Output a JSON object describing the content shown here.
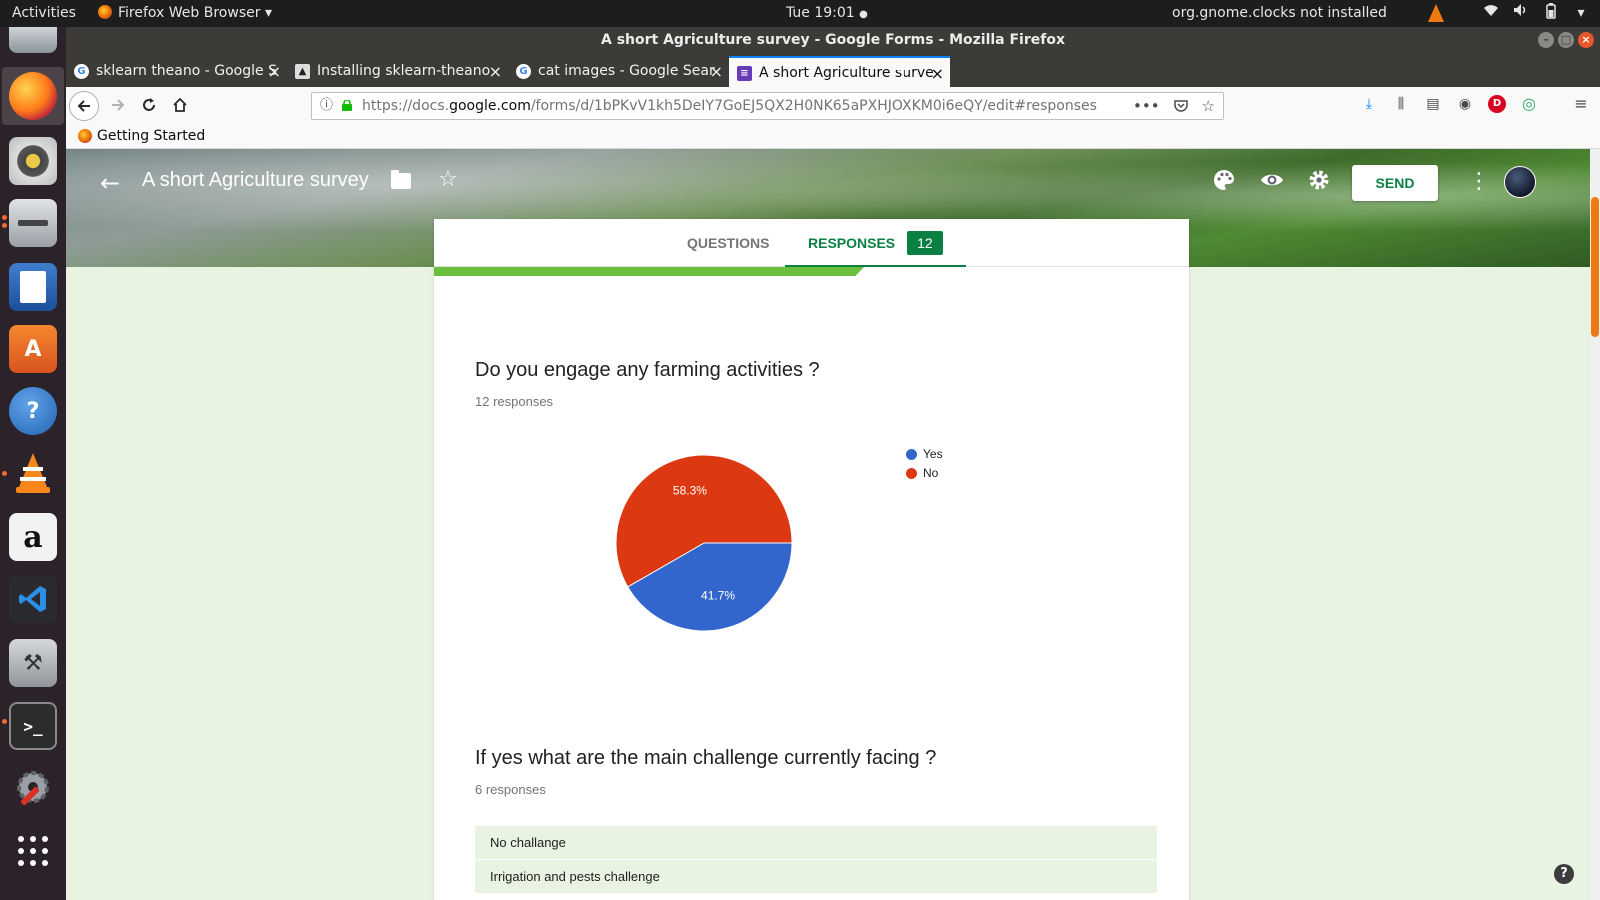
{
  "topbar": {
    "activities": "Activities",
    "app_name": "Firefox Web Browser",
    "clock": "Tue 19:01",
    "notice": "org.gnome.clocks not installed"
  },
  "window": {
    "title": "A short Agriculture survey - Google Forms - Mozilla Firefox"
  },
  "tabs": [
    {
      "label": "sklearn theano - Google S",
      "favicon": "google-g-icon"
    },
    {
      "label": "Installing sklearn-theano",
      "favicon": "site-icon"
    },
    {
      "label": "cat images - Google Sear",
      "favicon": "google-g-icon"
    },
    {
      "label": "A short Agriculture surve",
      "favicon": "forms-icon",
      "active": true
    }
  ],
  "navbar": {
    "url_prefix": "https://docs.",
    "url_domain": "google.com",
    "url_path": "/forms/d/1bPKvV1kh5DeIY7GoEJ5QX2H0NK65aPXHJOXKM0i6eQY/edit#responses"
  },
  "bookmarks": {
    "item": "Getting Started"
  },
  "form": {
    "title": "A short Agriculture survey",
    "send_label": "SEND",
    "tab_questions": "QUESTIONS",
    "tab_responses": "RESPONSES",
    "response_count": "12"
  },
  "questions": [
    {
      "title": "Do you engage any farming activities ?",
      "count": "12 responses"
    },
    {
      "title": "If yes what are the main challenge currently facing ?",
      "count": "6 responses"
    }
  ],
  "answers": [
    "No challange",
    "Irrigation and pests challenge"
  ],
  "chart_data": {
    "type": "pie",
    "categories": [
      "Yes",
      "No"
    ],
    "values": [
      41.7,
      58.3
    ],
    "labels": [
      "41.7%",
      "58.3%"
    ],
    "colors": [
      "#3366cc",
      "#dc3912"
    ],
    "legend": "right"
  },
  "colors": {
    "forms_green": "#0b8043",
    "progress_green": "#6bbf3c",
    "page_bg": "#e8f3e2"
  }
}
